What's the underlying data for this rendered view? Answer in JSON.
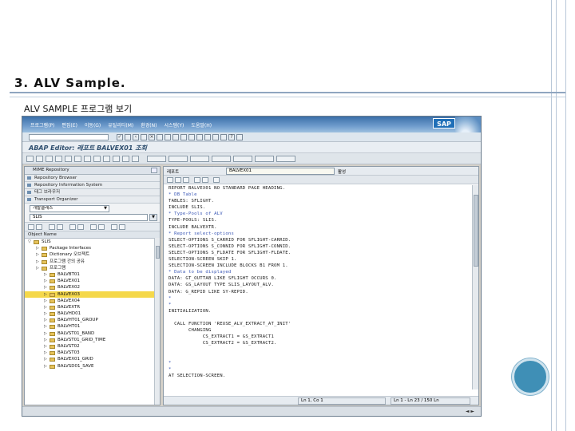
{
  "slide": {
    "title": "3. ALV Sample.",
    "subtitle": "ALV SAMPLE 프로그램 보기"
  },
  "sap": {
    "menu": [
      "프로그램(P)",
      "편집(E)",
      "이동(G)",
      "유틸리티(M)",
      "환경(N)",
      "시스템(Y)",
      "도움말(H)"
    ],
    "logo": "SAP",
    "title": "ABAP Editor: 레포트 BALVEX01 조회",
    "nav": {
      "header": "MIME Repository",
      "rows": [
        "Repository Browser",
        "Repository Information System",
        "태그 브라우저",
        "Transport Organizer"
      ],
      "select_value": "개발클래스",
      "input_value": "SLIS",
      "object_header": "Object Name",
      "tree": [
        {
          "label": "SLIS",
          "level": 0,
          "type": "folder"
        },
        {
          "label": "Package Interfaces",
          "level": 1,
          "type": "folder"
        },
        {
          "label": "Dictionary 오브젝트",
          "level": 1,
          "type": "folder"
        },
        {
          "label": "프로그램 간의 공유",
          "level": 1,
          "type": "folder"
        },
        {
          "label": "프로그램",
          "level": 1,
          "type": "folder"
        },
        {
          "label": "BALVBT01",
          "level": 2,
          "type": "folder"
        },
        {
          "label": "BALVEX01",
          "level": 2,
          "type": "folder"
        },
        {
          "label": "BALVEX02",
          "level": 2,
          "type": "folder"
        },
        {
          "label": "BALVEX03",
          "level": 2,
          "type": "folder",
          "selected": true
        },
        {
          "label": "BALVEX04",
          "level": 2,
          "type": "folder"
        },
        {
          "label": "BALVEXTR",
          "level": 2,
          "type": "folder"
        },
        {
          "label": "BALVHD01",
          "level": 2,
          "type": "folder"
        },
        {
          "label": "BALVHT01_GROUP",
          "level": 2,
          "type": "folder"
        },
        {
          "label": "BALVHT01",
          "level": 2,
          "type": "folder"
        },
        {
          "label": "BALVST01_BAND",
          "level": 2,
          "type": "folder"
        },
        {
          "label": "BALVST01_GRID_TIME",
          "level": 2,
          "type": "folder"
        },
        {
          "label": "BALVST02",
          "level": 2,
          "type": "folder"
        },
        {
          "label": "BALVST03",
          "level": 2,
          "type": "folder"
        },
        {
          "label": "BALVEX01_GRID",
          "level": 2,
          "type": "folder"
        },
        {
          "label": "BALVSD01_SAVE",
          "level": 2,
          "type": "folder"
        }
      ]
    },
    "editor": {
      "label": "레포트",
      "program": "BALVEX01",
      "status": "활성",
      "lines": [
        {
          "t": "REPORT BALVEX01 NO STANDARD PAGE HEADING.",
          "c": false
        },
        {
          "t": "* DB Table",
          "c": true
        },
        {
          "t": "TABLES: SFLIGHT.",
          "c": false
        },
        {
          "t": "INCLUDE SLIS.",
          "c": false
        },
        {
          "t": "* Type-Pools of ALV",
          "c": true
        },
        {
          "t": "TYPE-POOLS: SLIS.",
          "c": false
        },
        {
          "t": "INCLUDE BALVEXTR.",
          "c": false
        },
        {
          "t": "* Report select-options",
          "c": true
        },
        {
          "t": "SELECT-OPTIONS S_CARRID FOR SFLIGHT-CARRID.",
          "c": false
        },
        {
          "t": "SELECT-OPTIONS S_CONNID FOR SFLIGHT-CONNID.",
          "c": false
        },
        {
          "t": "SELECT-OPTIONS S_FLDATE FOR SFLIGHT-FLDATE.",
          "c": false
        },
        {
          "t": "SELECTION-SCREEN SKIP 1.",
          "c": false
        },
        {
          "t": "SELECTION-SCREEN INCLUDE BLOCKS B1 FROM 1.",
          "c": false
        },
        {
          "t": "* Data to be displayed",
          "c": true
        },
        {
          "t": "DATA: GT_OUTTAB LIKE SFLIGHT OCCURS 0.",
          "c": false
        },
        {
          "t": "DATA: GS_LAYOUT TYPE SLIS_LAYOUT_ALV.",
          "c": false
        },
        {
          "t": "DATA: G_REPID LIKE SY-REPID.",
          "c": false
        },
        {
          "t": "*",
          "c": true
        },
        {
          "t": "*",
          "c": true
        },
        {
          "t": "INITIALIZATION.",
          "c": false
        },
        {
          "t": "",
          "c": false
        },
        {
          "t": "  CALL FUNCTION 'REUSE_ALV_EXTRACT_AT_INIT'",
          "c": false
        },
        {
          "t": "       CHANGING",
          "c": false
        },
        {
          "t": "            CS_EXTRACT1 = GS_EXTRACT1",
          "c": false
        },
        {
          "t": "            CS_EXTRACT2 = GS_EXTRACT2.",
          "c": false
        },
        {
          "t": "",
          "c": false
        },
        {
          "t": "",
          "c": false
        },
        {
          "t": "*",
          "c": true
        },
        {
          "t": "*",
          "c": true
        },
        {
          "t": "AT SELECTION-SCREEN.",
          "c": false
        }
      ],
      "cursor": "Ln 1, Co 1",
      "range": "Ln 1 - Ln 23 / 150 Ln"
    }
  }
}
